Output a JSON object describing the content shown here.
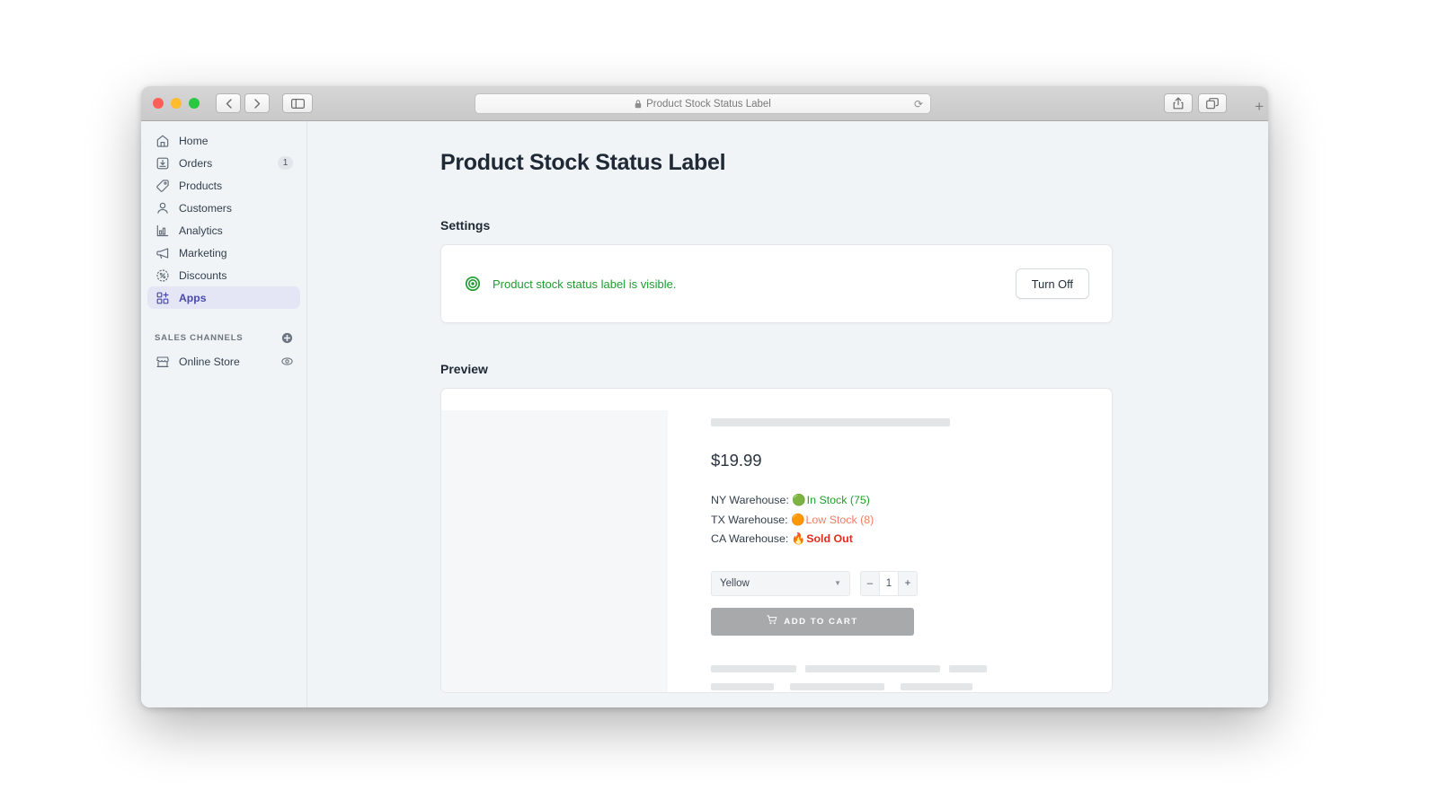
{
  "browser": {
    "address": "Product Stock Status Label",
    "lock_icon": "lock-icon",
    "reload_icon": "reload-icon",
    "back_label": "‹",
    "forward_label": "›",
    "traffic_lights": [
      "close",
      "minimize",
      "maximize"
    ],
    "new_tab_label": "+"
  },
  "sidebar": {
    "items": [
      {
        "label": "Home",
        "icon": "home-icon",
        "badge": "",
        "active": false
      },
      {
        "label": "Orders",
        "icon": "orders-icon",
        "badge": "1",
        "active": false
      },
      {
        "label": "Products",
        "icon": "products-icon",
        "badge": "",
        "active": false
      },
      {
        "label": "Customers",
        "icon": "customers-icon",
        "badge": "",
        "active": false
      },
      {
        "label": "Analytics",
        "icon": "analytics-icon",
        "badge": "",
        "active": false
      },
      {
        "label": "Marketing",
        "icon": "marketing-icon",
        "badge": "",
        "active": false
      },
      {
        "label": "Discounts",
        "icon": "discounts-icon",
        "badge": "",
        "active": false
      },
      {
        "label": "Apps",
        "icon": "apps-icon",
        "badge": "",
        "active": true
      }
    ],
    "section": {
      "title": "SALES CHANNELS",
      "add_icon": "plus-circle-icon",
      "channels": [
        {
          "label": "Online Store",
          "icon": "store-icon",
          "trailing_icon": "eye-icon"
        }
      ]
    }
  },
  "main": {
    "page_title": "Product Stock Status Label",
    "settings": {
      "heading": "Settings",
      "status_icon": "eye-icon",
      "status_message": "Product stock status label is visible.",
      "status_color": "#1e9c2f",
      "toggle_button": "Turn Off"
    },
    "preview": {
      "heading": "Preview",
      "price": "$19.99",
      "stock_rows": [
        {
          "warehouse": "NY Warehouse:",
          "dot": "🟢",
          "status": "In Stock (75)",
          "color": "#1fa12f"
        },
        {
          "warehouse": "TX Warehouse:",
          "dot": "🟠",
          "status": "Low Stock (8)",
          "color": "#ef7e65"
        },
        {
          "warehouse": "CA Warehouse:",
          "dot": "🔥",
          "status": "Sold Out",
          "color": "#e02b1d"
        }
      ],
      "variant_value": "Yellow",
      "variant_caret": "▼",
      "quantity": {
        "decrement": "–",
        "value": "1",
        "increment": "+"
      },
      "add_to_cart": "ADD TO CART",
      "cart_icon": "shopping-cart-icon"
    }
  }
}
